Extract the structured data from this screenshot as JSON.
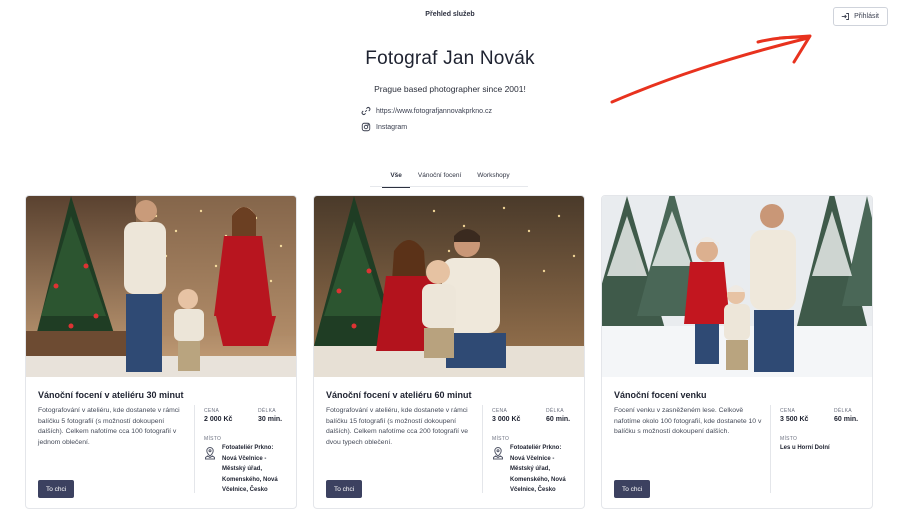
{
  "header": {
    "nav_label": "Přehled služeb",
    "login_label": "Přihlásit"
  },
  "profile": {
    "name": "Fotograf Jan Novák",
    "tagline": "Prague based photographer since 2001!",
    "website": "https://www.fotografjannovakprkno.cz",
    "instagram": "Instagram"
  },
  "tabs": [
    {
      "label": "Vše",
      "active": true
    },
    {
      "label": "Vánoční focení",
      "active": false
    },
    {
      "label": "Workshopy",
      "active": false
    }
  ],
  "labels": {
    "price": "CENA",
    "duration": "DÉLKA",
    "place": "MÍSTO",
    "cta": "To chci"
  },
  "cards": [
    {
      "title": "Vánoční focení v ateliéru 30 minut",
      "description": "Fotografování v ateliéru, kde dostanete v rámci balíčku 5 fotografií (s možností dokoupení dalších). Celkem nafotíme cca 100 fotografií v jednom oblečení.",
      "price": "2 000 Kč",
      "duration": "30 min.",
      "place_lines": [
        "Fotoateliér Prkno:",
        "Nová Včelnice -",
        "Městský úřad,",
        "Komenského, Nová",
        "Včelnice, Česko"
      ],
      "place_icon": "map-pin-icon"
    },
    {
      "title": "Vánoční focení v ateliéru 60 minut",
      "description": "Fotografování v ateliéru, kde dostanete v rámci balíčku 15 fotografií (s možností dokoupení dalších). Celkem nafotíme cca 200 fotografií ve dvou typech oblečení.",
      "price": "3 000 Kč",
      "duration": "60 min.",
      "place_lines": [
        "Fotoateliér Prkno:",
        "Nová Včelnice -",
        "Městský úřad,",
        "Komenského, Nová",
        "Včelnice, Česko"
      ],
      "place_icon": "map-pin-icon"
    },
    {
      "title": "Vánoční focení venku",
      "description": "Focení venku v zasněženém lese. Celkově nafotíme okolo 100 fotografií, kde dostanete 10 v balíčku s možností dokoupení dalších.",
      "price": "3 500 Kč",
      "duration": "60 min.",
      "place_lines": [
        "Les u Horní Dolní"
      ],
      "place_icon": null
    }
  ],
  "colors": {
    "accent_button": "#3c4160",
    "annotation_arrow": "#e8321e"
  }
}
